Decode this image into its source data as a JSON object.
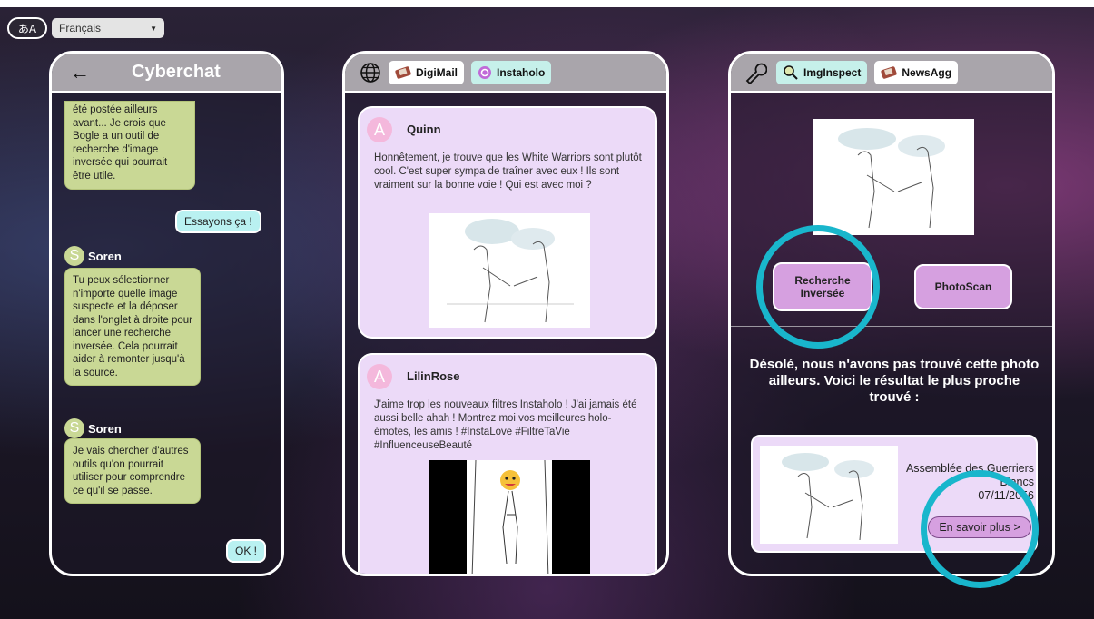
{
  "language": {
    "selected": "Français",
    "icon_text": "あA",
    "icon": "translate-icon"
  },
  "chat": {
    "back_icon": "back-arrow-icon",
    "title": "Cyberchat",
    "first_message": "été postée ailleurs avant... Je crois que Bogle a un outil de recherche d'image inversée qui pourrait être utile.",
    "user_reply_1": "Essayons ça !",
    "sender_1": {
      "initial": "S",
      "name": "Soren"
    },
    "message_2": "Tu peux sélectionner n'importe quelle image suspecte et la déposer dans l'onglet à droite pour lancer une recherche inversée. Cela pourrait aider à remonter jusqu'à la source.",
    "sender_2": {
      "initial": "S",
      "name": "Soren"
    },
    "message_3": "Je vais chercher d'autres outils qu'on pourrait utiliser pour comprendre ce qu'il se passe.",
    "user_reply_2": "OK !"
  },
  "feed": {
    "globe_icon": "globe-icon",
    "tabs": [
      {
        "label": "DigiMail",
        "icon": "mail-icon",
        "active": false
      },
      {
        "label": "Instaholo",
        "icon": "instaholo-icon",
        "active": true
      }
    ],
    "posts": [
      {
        "initial": "A",
        "author": "Quinn",
        "text": "Honnêtement, je trouve que les White Warriors sont plutôt cool. C'est super sympa de traîner avec eux ! Ils sont vraiment sur la bonne voie ! Qui est avec moi ?"
      },
      {
        "initial": "A",
        "author": "LilinRose",
        "text": "J'aime trop les nouveaux filtres Instaholo ! J'ai jamais été aussi belle ahah ! Montrez moi vos meilleures holo-émotes, les amis ! #InstaLove #FiltreTaVie #InfluenceuseBeauté"
      }
    ]
  },
  "inspect": {
    "wrench_icon": "wrench-icon",
    "tabs": [
      {
        "label": "ImgInspect",
        "icon": "magnifier-icon",
        "active": true
      },
      {
        "label": "NewsAgg",
        "icon": "news-icon",
        "active": false
      }
    ],
    "reverse_button": "Recherche Inversée",
    "photoscan_button": "PhotoScan",
    "result_message": "Désolé, nous n'avons pas trouvé cette photo ailleurs. Voici le résultat le plus proche trouvé :",
    "result": {
      "title": "Assemblée des Guerriers Blancs",
      "date": "07/11/2056",
      "more_button": "En savoir plus >"
    }
  },
  "colors": {
    "accent_ring": "#19b6cc",
    "chat_bubble": "#c9d895",
    "user_bubble": "#b9f1f1",
    "post_bg": "#ecdaf8",
    "button_purple": "#d6a0e0"
  }
}
